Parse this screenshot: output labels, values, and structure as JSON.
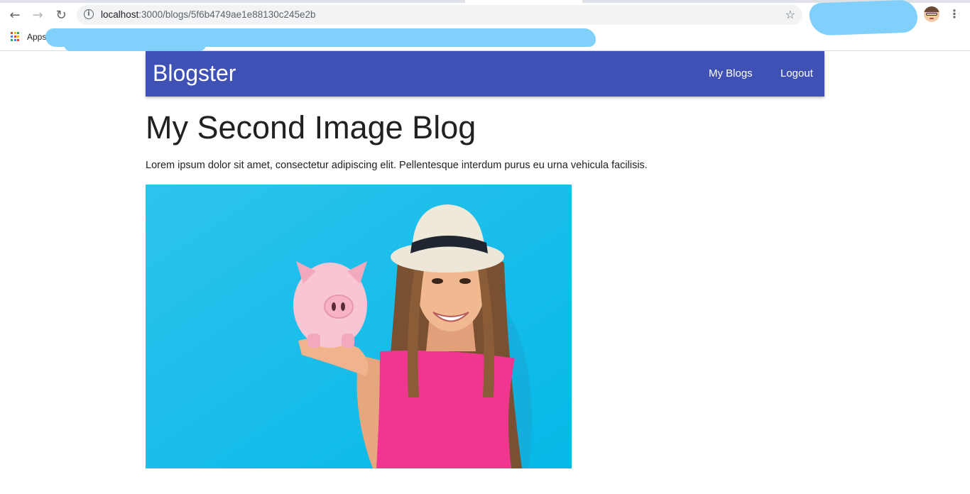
{
  "browser": {
    "url_host": "localhost",
    "url_path": ":3000/blogs/5f6b4749ae1e88130c245e2b",
    "bookmarks_apps_label": "Apps",
    "icons": {
      "back": "back-arrow-icon",
      "forward": "forward-arrow-icon",
      "reload": "reload-icon",
      "info": "info-icon",
      "star": "star-icon",
      "menu": "menu-dots-icon",
      "apps": "apps-grid-icon"
    }
  },
  "navbar": {
    "brand": "Blogster",
    "links": [
      {
        "label": "My Blogs"
      },
      {
        "label": "Logout"
      }
    ],
    "color": "#3f51b5"
  },
  "post": {
    "title": "My Second Image Blog",
    "content": "Lorem ipsum dolor sit amet, consectetur adipiscing elit. Pellentesque interdum purus eu urna vehicula facilisis.",
    "image_alt": "Woman in hat holding a pink piggy bank"
  },
  "colors": {
    "redaction": "#80d0fb",
    "image_background": "#1fc2ec",
    "shirt": "#f0368e"
  }
}
